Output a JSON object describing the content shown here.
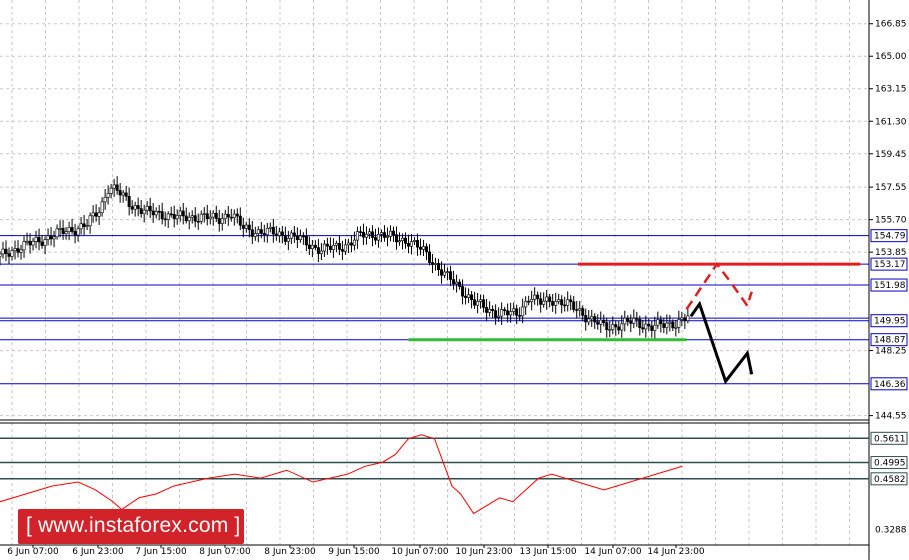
{
  "chart_data": [
    {
      "type": "candlestick",
      "title": "",
      "instrument": "",
      "price_ticks": [
        166.85,
        165.0,
        163.15,
        161.3,
        159.45,
        157.55,
        155.7,
        153.85,
        148.25,
        144.55
      ],
      "x_tick_labels": [
        "6 Jun 07:00",
        "6 Jun 23:00",
        "7 Jun 15:00",
        "8 Jun 07:00",
        "8 Jun 23:00",
        "9 Jun 15:00",
        "10 Jun 07:00",
        "10 Jun 23:00",
        "13 Jun 15:00",
        "14 Jun 07:00",
        "14 Jun 23:00"
      ],
      "ylim": [
        144.3,
        168.2
      ],
      "levels": [
        {
          "value": 154.79,
          "label": "154.79",
          "color": "#0000cc"
        },
        {
          "value": 153.17,
          "label": "153.17",
          "color": "#0000cc"
        },
        {
          "value": 151.98,
          "label": "151.98",
          "color": "#0000cc"
        },
        {
          "value": 149.95,
          "label": "149.95",
          "color": "#0000cc"
        },
        {
          "value": 148.87,
          "label": "148.87",
          "color": "#0000cc"
        },
        {
          "value": 146.36,
          "label": "146.36",
          "color": "#0000cc"
        }
      ],
      "extra_line": {
        "value": 150.1,
        "color": "#0000cc"
      },
      "resistance_line": {
        "value": 153.17,
        "x_from": 0.665,
        "x_to": 0.99,
        "color": "#e02020"
      },
      "support_line": {
        "value": 148.87,
        "x_from": 0.47,
        "x_to": 0.79,
        "color": "#33bb33"
      },
      "close_path": [
        [
          0,
          153.6
        ],
        [
          0.02,
          154.1
        ],
        [
          0.04,
          154.4
        ],
        [
          0.06,
          154.8
        ],
        [
          0.08,
          155.1
        ],
        [
          0.1,
          155.4
        ],
        [
          0.115,
          156.3
        ],
        [
          0.125,
          157.6
        ],
        [
          0.135,
          157.3
        ],
        [
          0.15,
          156.6
        ],
        [
          0.17,
          156.1
        ],
        [
          0.19,
          156.0
        ],
        [
          0.21,
          155.8
        ],
        [
          0.23,
          155.9
        ],
        [
          0.25,
          155.7
        ],
        [
          0.265,
          156.1
        ],
        [
          0.28,
          155.2
        ],
        [
          0.3,
          155.0
        ],
        [
          0.32,
          154.9
        ],
        [
          0.34,
          154.7
        ],
        [
          0.355,
          154.3
        ],
        [
          0.37,
          154.0
        ],
        [
          0.385,
          154.1
        ],
        [
          0.4,
          154.3
        ],
        [
          0.415,
          154.8
        ],
        [
          0.43,
          154.9
        ],
        [
          0.45,
          154.7
        ],
        [
          0.47,
          154.5
        ],
        [
          0.49,
          153.8
        ],
        [
          0.5,
          153.2
        ],
        [
          0.515,
          152.4
        ],
        [
          0.53,
          151.8
        ],
        [
          0.545,
          151.0
        ],
        [
          0.56,
          150.6
        ],
        [
          0.575,
          150.4
        ],
        [
          0.595,
          150.3
        ],
        [
          0.61,
          151.4
        ],
        [
          0.62,
          150.9
        ],
        [
          0.635,
          151.2
        ],
        [
          0.65,
          150.9
        ],
        [
          0.665,
          150.6
        ],
        [
          0.68,
          150.0
        ],
        [
          0.695,
          149.6
        ],
        [
          0.71,
          149.7
        ],
        [
          0.73,
          149.9
        ],
        [
          0.75,
          149.6
        ],
        [
          0.765,
          149.7
        ],
        [
          0.78,
          149.9
        ],
        [
          0.795,
          150.2
        ]
      ],
      "forecast_black": [
        [
          0.795,
          150.2
        ],
        [
          0.805,
          150.9
        ],
        [
          0.835,
          146.5
        ],
        [
          0.86,
          148.1
        ],
        [
          0.865,
          146.9
        ]
      ],
      "forecast_red": [
        [
          0.79,
          150.6
        ],
        [
          0.825,
          153.17
        ],
        [
          0.84,
          152.2
        ],
        [
          0.86,
          150.8
        ],
        [
          0.865,
          151.6
        ]
      ]
    },
    {
      "type": "line",
      "title": "",
      "y_ticks": [
        0.3288
      ],
      "ylim": [
        0.29,
        0.6
      ],
      "levels": [
        {
          "value": 0.5611,
          "label": "0.5611",
          "color": "#000000"
        },
        {
          "value": 0.4995,
          "label": "0.4995",
          "color": "#000000"
        },
        {
          "value": 0.4582,
          "label": "0.4582",
          "color": "#000000"
        }
      ],
      "series": [
        {
          "color": "#ff0000",
          "points": [
            [
              0,
              0.4
            ],
            [
              0.03,
              0.42
            ],
            [
              0.06,
              0.44
            ],
            [
              0.09,
              0.45
            ],
            [
              0.11,
              0.43
            ],
            [
              0.13,
              0.4
            ],
            [
              0.14,
              0.38
            ],
            [
              0.16,
              0.41
            ],
            [
              0.18,
              0.42
            ],
            [
              0.2,
              0.44
            ],
            [
              0.22,
              0.45
            ],
            [
              0.24,
              0.46
            ],
            [
              0.27,
              0.47
            ],
            [
              0.3,
              0.46
            ],
            [
              0.33,
              0.48
            ],
            [
              0.36,
              0.45
            ],
            [
              0.38,
              0.46
            ],
            [
              0.4,
              0.47
            ],
            [
              0.42,
              0.49
            ],
            [
              0.44,
              0.5
            ],
            [
              0.455,
              0.52
            ],
            [
              0.47,
              0.56
            ],
            [
              0.485,
              0.57
            ],
            [
              0.5,
              0.56
            ],
            [
              0.51,
              0.5
            ],
            [
              0.52,
              0.44
            ],
            [
              0.53,
              0.42
            ],
            [
              0.545,
              0.37
            ],
            [
              0.56,
              0.39
            ],
            [
              0.575,
              0.41
            ],
            [
              0.59,
              0.4
            ],
            [
              0.605,
              0.43
            ],
            [
              0.62,
              0.46
            ],
            [
              0.635,
              0.47
            ],
            [
              0.65,
              0.46
            ],
            [
              0.665,
              0.45
            ],
            [
              0.68,
              0.44
            ],
            [
              0.695,
              0.43
            ],
            [
              0.71,
              0.44
            ],
            [
              0.725,
              0.45
            ],
            [
              0.74,
              0.46
            ],
            [
              0.755,
              0.47
            ],
            [
              0.77,
              0.48
            ],
            [
              0.785,
              0.49
            ]
          ]
        }
      ]
    }
  ],
  "watermark": {
    "text": "[ www.instaforex.com ]"
  }
}
